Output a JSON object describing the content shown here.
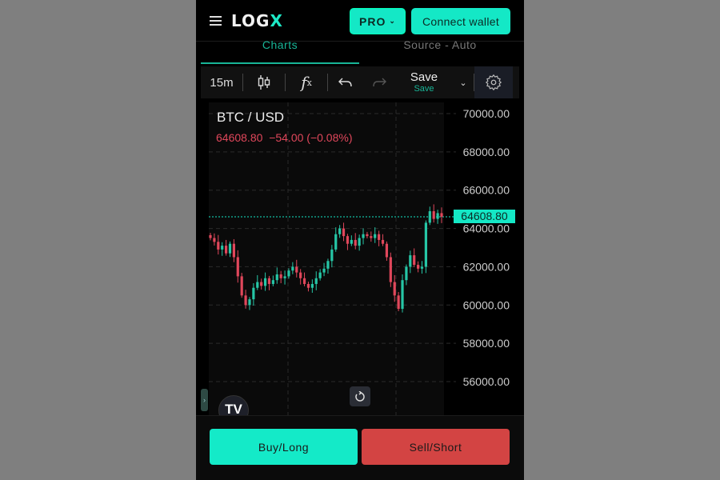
{
  "header": {
    "logo": "LOGX",
    "pro_label": "PRO",
    "connect_label": "Connect wallet"
  },
  "tabs": [
    {
      "label": "Charts",
      "active": true
    },
    {
      "label": "Source - Auto",
      "active": false
    }
  ],
  "toolbar": {
    "interval": "15m",
    "save_label": "Save",
    "save_sub": "Save",
    "icons": [
      "candles-icon",
      "indicators-icon",
      "undo-icon",
      "redo-icon",
      "chevron-down-icon",
      "gear-icon"
    ]
  },
  "chart": {
    "symbol": "BTC / USD",
    "last_price": "64608.80",
    "change": "−54.00 (−0.08%)",
    "last_price_tag": "64608.80"
  },
  "chart_data": {
    "type": "candlestick",
    "title": "BTC / USD",
    "y_ticks": [
      "70000.00",
      "68000.00",
      "66000.00",
      "64000.00",
      "62000.00",
      "60000.00",
      "58000.00",
      "56000.00"
    ],
    "ylim": [
      55000,
      70500
    ],
    "last": 64608.8,
    "closes": [
      63500,
      63300,
      62900,
      63100,
      62700,
      63200,
      62500,
      61500,
      60500,
      60000,
      60300,
      60900,
      61200,
      61000,
      61400,
      61100,
      61300,
      61600,
      61400,
      61500,
      61800,
      62000,
      61700,
      61400,
      61100,
      60900,
      61100,
      61400,
      61700,
      61900,
      62300,
      62900,
      63700,
      64000,
      63600,
      63200,
      63400,
      63100,
      63500,
      63700,
      63600,
      63500,
      63700,
      63400,
      63200,
      62500,
      61200,
      60500,
      59800,
      61300,
      62000,
      62600,
      62100,
      61900,
      62000,
      64300,
      64900,
      64500,
      64800,
      64608.8
    ],
    "colors": {
      "up": "#26c6a6",
      "down": "#e0475b",
      "grid": "#2a2a2a"
    }
  },
  "actions": {
    "buy_label": "Buy/Long",
    "sell_label": "Sell/Short"
  },
  "colors": {
    "accent": "#14e8c6",
    "sell": "#d34443",
    "price_down": "#e0475b"
  }
}
